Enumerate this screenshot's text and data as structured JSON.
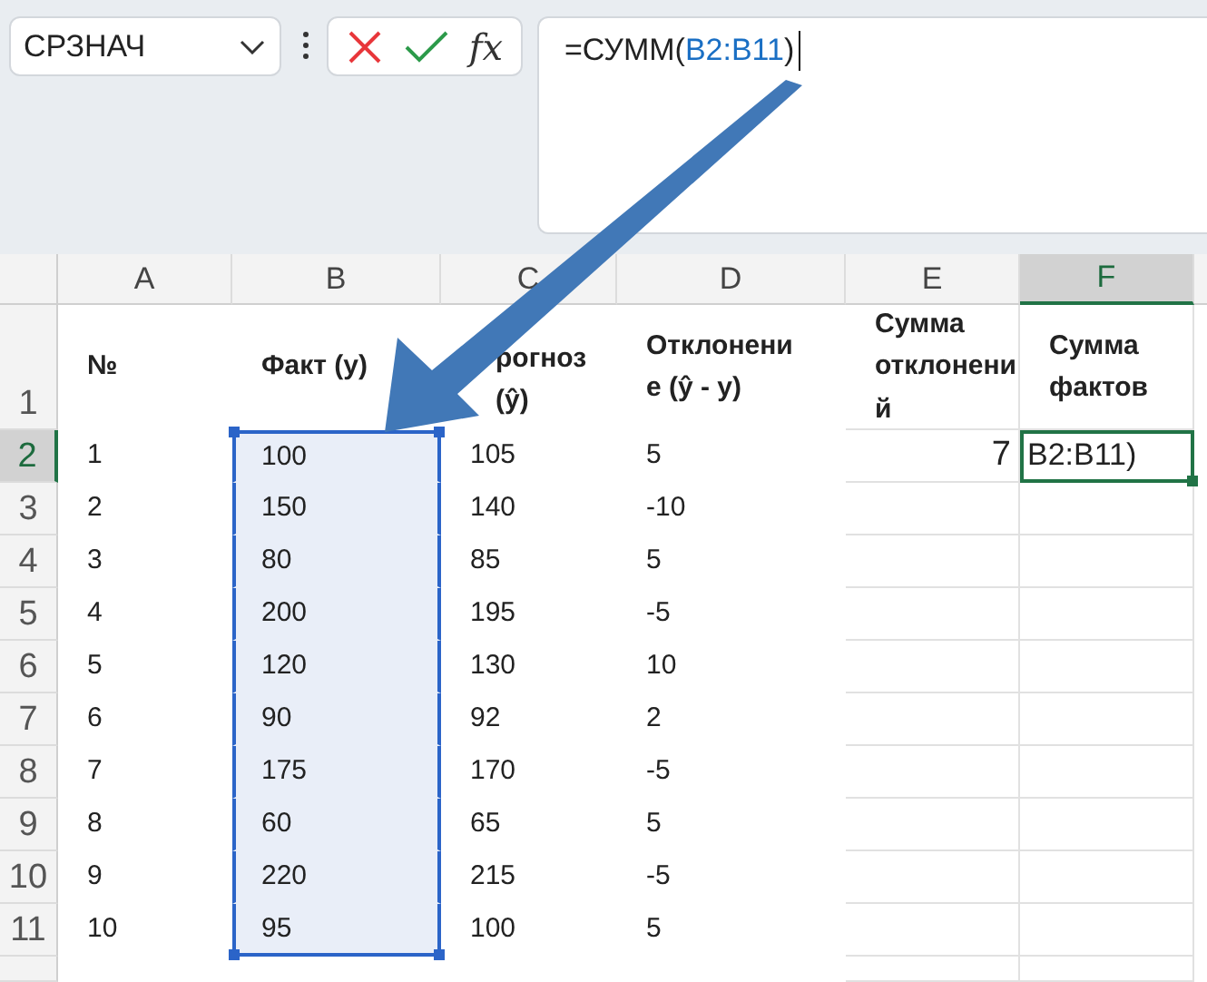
{
  "name_box": {
    "value": "СРЗНАЧ"
  },
  "formula_bar": {
    "fx_label": "fx",
    "formula": [
      {
        "kind": "text",
        "text": "=СУММ("
      },
      {
        "kind": "reference",
        "text": "B2:B11"
      },
      {
        "kind": "text",
        "text": ")"
      }
    ]
  },
  "columns": [
    {
      "label": "A",
      "selected": false
    },
    {
      "label": "B",
      "selected": false
    },
    {
      "label": "C",
      "selected": false
    },
    {
      "label": "D",
      "selected": false
    },
    {
      "label": "E",
      "selected": false
    },
    {
      "label": "F",
      "selected": true
    }
  ],
  "rows": [
    {
      "number": "1",
      "selected": false,
      "cells": [
        "№",
        "Факт (y)",
        "рогноз (ŷ)",
        "Отклонение (ŷ - y)",
        "Сумма отклонений",
        "Сумма фактов"
      ]
    },
    {
      "number": "2",
      "selected": true,
      "cells": [
        "1",
        {
          "text": "100",
          "in_selection": true
        },
        "105",
        "5",
        {
          "text": "7",
          "kind": "number"
        },
        {
          "text": "B2:B11)",
          "kind": "editing"
        }
      ]
    },
    {
      "number": "3",
      "selected": false,
      "cells": [
        "2",
        {
          "text": "150",
          "in_selection": true
        },
        "140",
        "-10"
      ]
    },
    {
      "number": "4",
      "selected": false,
      "cells": [
        "3",
        {
          "text": "80",
          "in_selection": true
        },
        "85",
        "5"
      ]
    },
    {
      "number": "5",
      "selected": false,
      "cells": [
        "4",
        {
          "text": "200",
          "in_selection": true
        },
        "195",
        "-5"
      ]
    },
    {
      "number": "6",
      "selected": false,
      "cells": [
        "5",
        {
          "text": "120",
          "in_selection": true
        },
        "130",
        "10"
      ]
    },
    {
      "number": "7",
      "selected": false,
      "cells": [
        "6",
        {
          "text": "90",
          "in_selection": true
        },
        "92",
        "2"
      ]
    },
    {
      "number": "8",
      "selected": false,
      "cells": [
        "7",
        {
          "text": "175",
          "in_selection": true
        },
        "170",
        "-5"
      ]
    },
    {
      "number": "9",
      "selected": false,
      "cells": [
        "8",
        {
          "text": "60",
          "in_selection": true
        },
        "65",
        "5"
      ]
    },
    {
      "number": "10",
      "selected": false,
      "cells": [
        "9",
        {
          "text": "220",
          "in_selection": true
        },
        "215",
        "-5"
      ]
    },
    {
      "number": "11",
      "selected": false,
      "cells": [
        "10",
        {
          "text": "95",
          "in_selection": true
        },
        "100",
        "5"
      ]
    }
  ]
}
